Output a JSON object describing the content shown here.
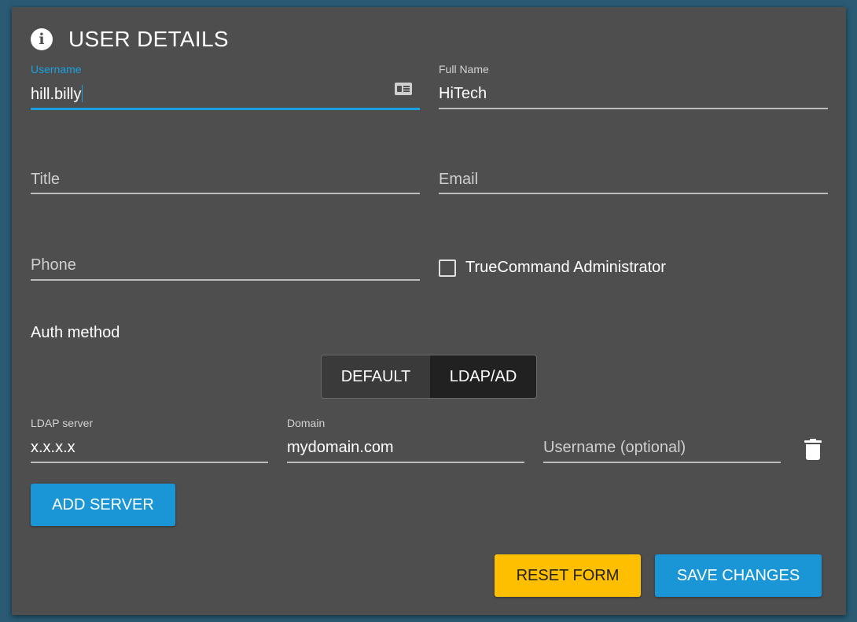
{
  "colors": {
    "accent": "#1aa0e0",
    "card_bg": "#4e4e4e",
    "reset_button": "#fdbf00",
    "primary_button": "#1a96d6"
  },
  "header": {
    "icon": "info-icon",
    "icon_glyph": "i",
    "title": "USER DETAILS"
  },
  "fields": {
    "username": {
      "label": "Username",
      "value": "hill.billy",
      "icon": "id-card-icon"
    },
    "full_name": {
      "label": "Full Name",
      "value": "HiTech"
    },
    "title": {
      "placeholder": "Title"
    },
    "email": {
      "placeholder": "Email"
    },
    "phone": {
      "placeholder": "Phone"
    }
  },
  "admin_checkbox": {
    "label": "TrueCommand Administrator",
    "checked": false
  },
  "auth": {
    "label": "Auth method",
    "options": [
      "DEFAULT",
      "LDAP/AD"
    ],
    "selected": "LDAP/AD"
  },
  "ldap": {
    "server": {
      "label": "LDAP server",
      "value": "x.x.x.x"
    },
    "domain": {
      "label": "Domain",
      "value": "mydomain.com"
    },
    "username": {
      "placeholder": "Username (optional)"
    },
    "delete_icon": "trash-icon"
  },
  "buttons": {
    "add_server": "ADD SERVER",
    "reset_form": "RESET FORM",
    "save_changes": "SAVE CHANGES"
  }
}
